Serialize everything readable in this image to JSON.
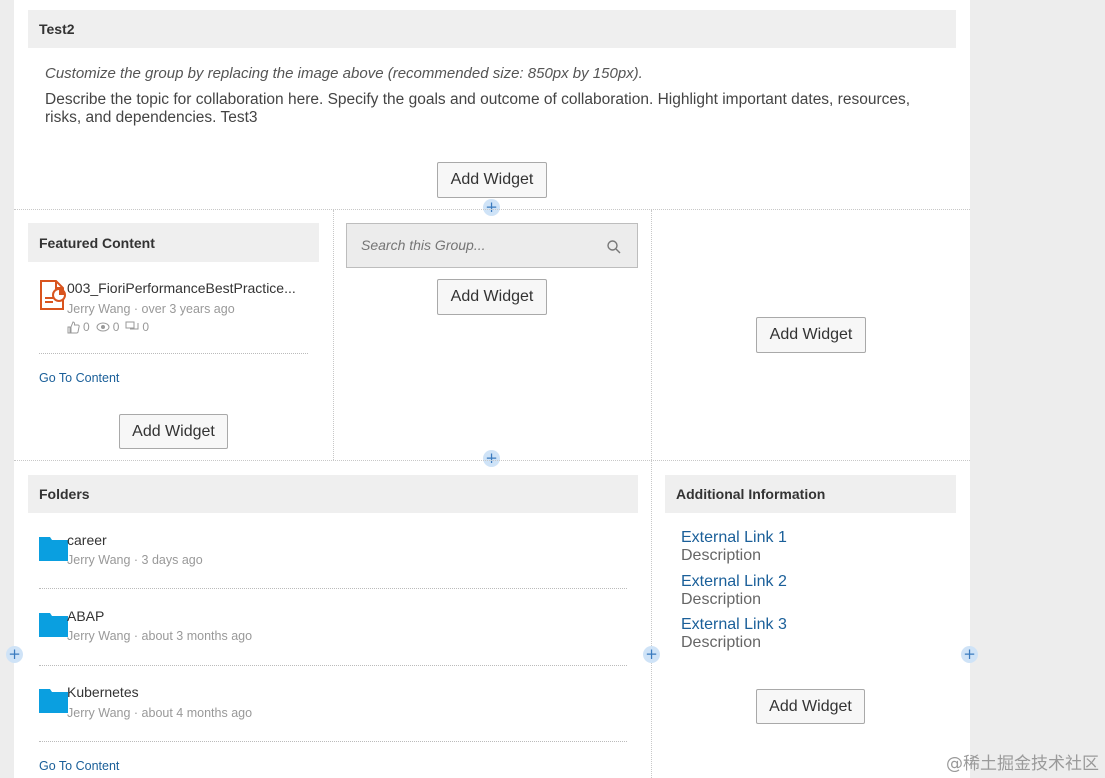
{
  "header": {
    "title": "Test2",
    "hint": "Customize the group by replacing the image above (recommended size: 850px by 150px).",
    "description": "Describe the topic for collaboration here. Specify the goals and outcome of collaboration. Highlight important dates, resources, risks, and dependencies. Test3"
  },
  "add_widget_label": "Add Widget",
  "featured": {
    "title": "Featured Content",
    "item": {
      "name": "003_FioriPerformanceBestPractice...",
      "meta": "Jerry Wang · over 3 years ago",
      "likes": "0",
      "views": "0",
      "comments": "0"
    },
    "go_to": "Go To Content"
  },
  "search": {
    "placeholder": "Search this Group..."
  },
  "folders": {
    "title": "Folders",
    "items": [
      {
        "name": "career",
        "meta": "Jerry Wang · 3 days ago"
      },
      {
        "name": "ABAP",
        "meta": "Jerry Wang · about 3 months ago"
      },
      {
        "name": "Kubernetes",
        "meta": "Jerry Wang · about 4 months ago"
      }
    ],
    "go_to": "Go To Content"
  },
  "additional": {
    "title": "Additional Information",
    "links": [
      {
        "label": "External Link 1",
        "desc": "Description"
      },
      {
        "label": "External Link 2",
        "desc": "Description"
      },
      {
        "label": "External Link 3",
        "desc": "Description"
      }
    ]
  },
  "watermark": "@稀土掘金技术社区",
  "colors": {
    "link": "#1a5f99",
    "folder": "#0a9fe0",
    "doc_icon": "#d9541e",
    "plus": "#cfe3f7"
  }
}
